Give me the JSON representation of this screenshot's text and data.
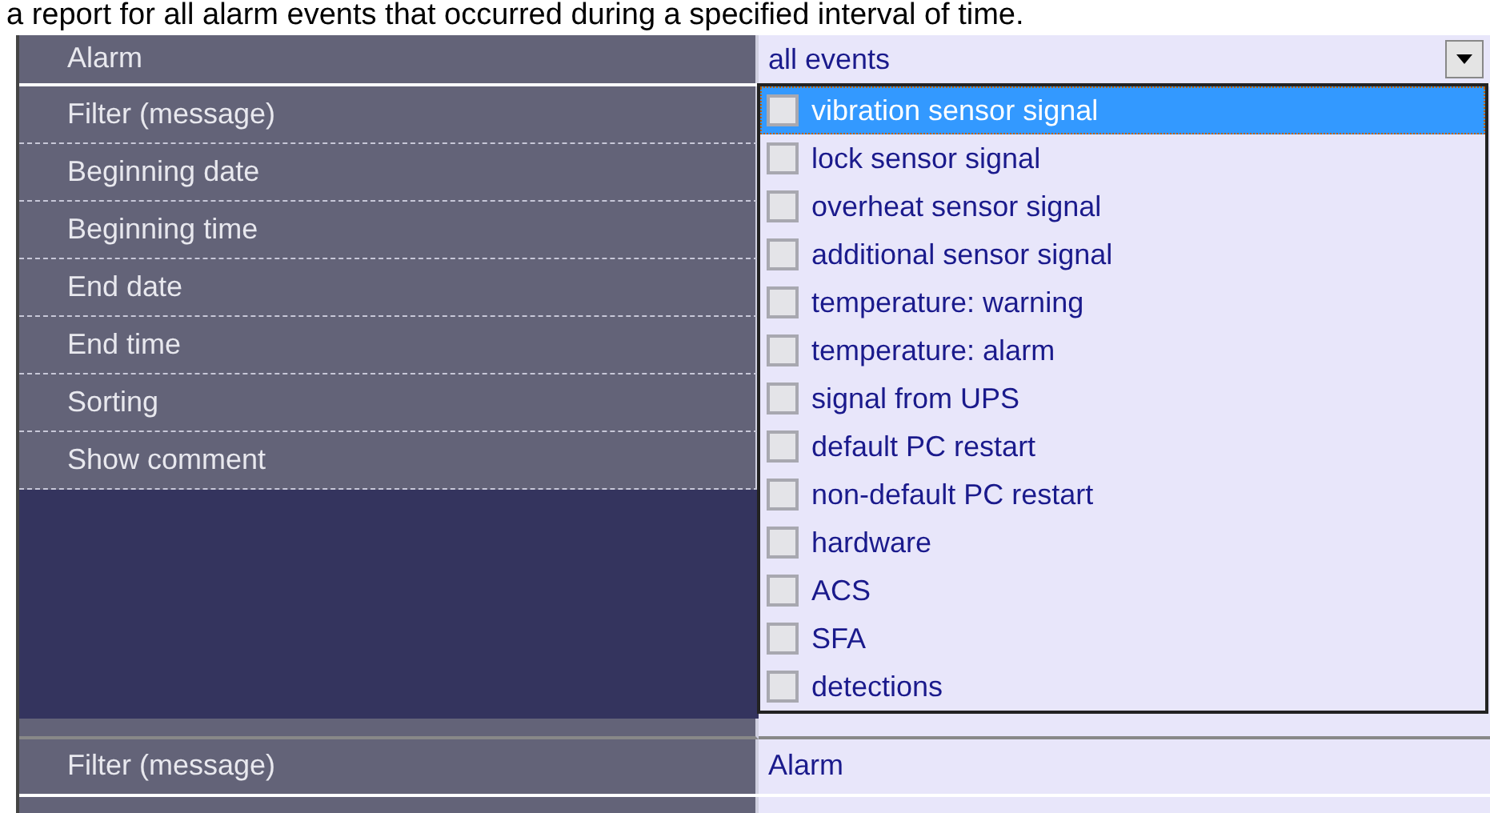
{
  "caption": "a report for all alarm events that occurred during a specified interval of time.",
  "properties": [
    {
      "label": "Alarm",
      "value": "all events",
      "kind": "dropdown"
    },
    {
      "label": "Filter (message)",
      "kind": "plain"
    },
    {
      "label": "Beginning date",
      "kind": "plain"
    },
    {
      "label": "Beginning time",
      "kind": "plain"
    },
    {
      "label": "End date",
      "kind": "plain"
    },
    {
      "label": "End time",
      "kind": "plain"
    },
    {
      "label": "Sorting",
      "kind": "plain"
    },
    {
      "label": "Show comment",
      "kind": "plain"
    }
  ],
  "dropdown": {
    "items": [
      {
        "label": "vibration sensor signal",
        "checked": false,
        "selected": true
      },
      {
        "label": "lock sensor signal",
        "checked": false,
        "selected": false
      },
      {
        "label": "overheat sensor signal",
        "checked": false,
        "selected": false
      },
      {
        "label": "additional sensor signal",
        "checked": false,
        "selected": false
      },
      {
        "label": "temperature: warning",
        "checked": false,
        "selected": false
      },
      {
        "label": "temperature: alarm",
        "checked": false,
        "selected": false
      },
      {
        "label": "signal from UPS",
        "checked": false,
        "selected": false
      },
      {
        "label": "default PC restart",
        "checked": false,
        "selected": false
      },
      {
        "label": "non-default PC restart",
        "checked": false,
        "selected": false
      },
      {
        "label": "hardware",
        "checked": false,
        "selected": false
      },
      {
        "label": "ACS",
        "checked": false,
        "selected": false
      },
      {
        "label": "SFA",
        "checked": false,
        "selected": false
      },
      {
        "label": "detections",
        "checked": false,
        "selected": false
      }
    ]
  },
  "lower_properties": [
    {
      "label": "Filter (message)",
      "value": "Alarm"
    }
  ]
}
